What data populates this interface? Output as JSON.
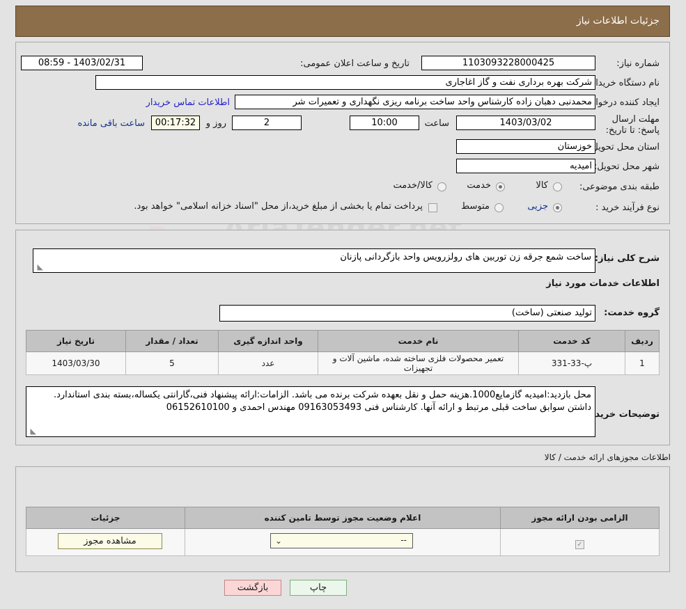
{
  "header": {
    "title": "جزئیات اطلاعات نیاز"
  },
  "watermark": {
    "text": "AriaTender.net"
  },
  "fields": {
    "need_number_label": "شماره نیاز:",
    "need_number_value": "1103093228000425",
    "announce_label": "تاریخ و ساعت اعلان عمومی:",
    "announce_value": "1403/02/31 - 08:59",
    "buyer_org_label": "نام دستگاه خریدار:",
    "buyer_org_value": "شرکت بهره برداری نفت و گاز اغاجاری",
    "creator_label": "ایجاد کننده درخواست:",
    "creator_value": "محمدنبی دهبان زاده کارشناس واحد ساخت برنامه ریزی نگهداری  و تعمیرات شر",
    "contact_link": "اطلاعات تماس خریدار",
    "deadline_label": "مهلت ارسال پاسخ: تا تاریخ:",
    "deadline_date": "1403/03/02",
    "deadline_hour_label": "ساعت",
    "deadline_hour": "10:00",
    "days_remaining": "2",
    "days_label": "روز و",
    "countdown": "00:17:32",
    "hours_remaining_label": "ساعت باقی مانده",
    "province_label": "استان محل تحویل:",
    "province_value": "خوزستان",
    "city_label": "شهر محل تحویل:",
    "city_value": "امیدیه",
    "category_label": "طبقه بندی موضوعی:",
    "category_options": [
      "کالا",
      "خدمت",
      "کالا/خدمت"
    ],
    "category_selected": "خدمت",
    "process_label": "نوع فرآیند خرید :",
    "process_options": [
      "جزیی",
      "متوسط"
    ],
    "process_selected": "جزیی",
    "payment_note": "پرداخت تمام یا بخشی از مبلغ خرید،از محل \"اسناد خزانه اسلامی\" خواهد بود.",
    "general_desc_label": "شرح کلی نیاز:",
    "general_desc_value": "ساخت  شمع جرقه زن توربین های رولزرویس واحد بازگردانی پازنان",
    "services_section_title": "اطلاعات خدمات مورد نیاز",
    "service_group_label": "گروه خدمت:",
    "service_group_value": "تولید صنعتی (ساخت)",
    "buyer_notes_label": "توضیحات خریدار:",
    "buyer_notes_value": "محل بازدید:امیدیه گازمایع1000.هزینه حمل و نقل بعهده شرکت برنده می باشد. الزامات:ارائه پیشنهاد فنی،گارانتی یکساله،بسته بندی استاندارد. داشتن سوابق ساخت  قبلی مرتبط و ارائه آنها. کارشناس فنی 09163053493 مهندس احمدی و 06152610100"
  },
  "services_table": {
    "headers": [
      "ردیف",
      "کد خدمت",
      "نام خدمت",
      "واحد اندازه گیری",
      "تعداد / مقدار",
      "تاریخ نیاز"
    ],
    "rows": [
      {
        "row": "1",
        "code": "پ-33-331",
        "name": "تعمیر محصولات فلزی ساخته شده، ماشین آلات و تجهیزات",
        "unit": "عدد",
        "qty": "5",
        "date": "1403/03/30"
      }
    ]
  },
  "licenses": {
    "section_title": "اطلاعات مجوزهای ارائه خدمت / کالا",
    "headers": [
      "الزامی بودن ارائه مجوز",
      "اعلام وضعیت مجوز توسط تامین کننده",
      "جزئیات"
    ],
    "rows": [
      {
        "required_checked": true,
        "status_value": "--",
        "detail_button": "مشاهده مجوز"
      }
    ]
  },
  "footer": {
    "print_button": "چاپ",
    "back_button": "بازگشت"
  }
}
